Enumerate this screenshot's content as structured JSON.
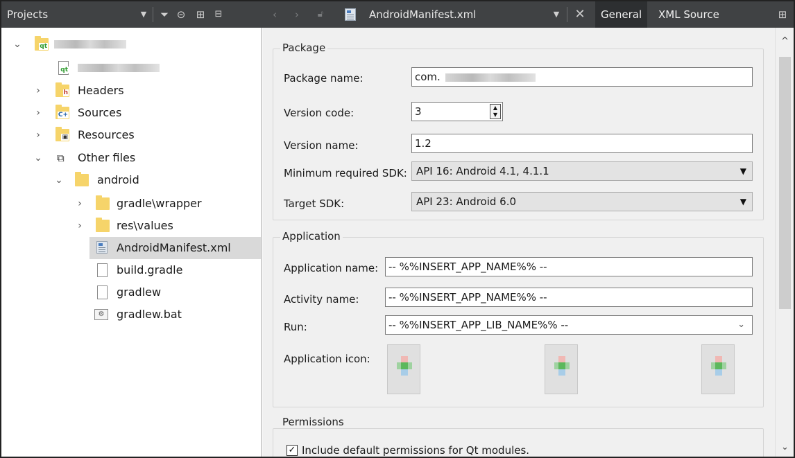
{
  "toolbar": {
    "projects_label": "Projects",
    "filename": "AndroidManifest.xml",
    "tabs": [
      {
        "label": "General",
        "active": true
      },
      {
        "label": "XML Source",
        "active": false
      }
    ]
  },
  "tree": {
    "items": [
      {
        "label": "",
        "icon": "qt-project-folder-icon",
        "expanded": true,
        "redacted": true
      },
      {
        "label": "",
        "icon": "qt-pro-file-icon",
        "redacted": true
      },
      {
        "label": "Headers",
        "icon": "headers-folder-icon",
        "expanded": false
      },
      {
        "label": "Sources",
        "icon": "sources-folder-icon",
        "expanded": false
      },
      {
        "label": "Resources",
        "icon": "resources-folder-icon",
        "expanded": false
      },
      {
        "label": "Other files",
        "icon": "other-files-icon",
        "expanded": true
      },
      {
        "label": "android",
        "icon": "folder-icon",
        "expanded": true
      },
      {
        "label": "gradle\\wrapper",
        "icon": "folder-icon",
        "expanded": false
      },
      {
        "label": "res\\values",
        "icon": "folder-icon",
        "expanded": false
      },
      {
        "label": "AndroidManifest.xml",
        "icon": "xml-file-icon",
        "selected": true
      },
      {
        "label": "build.gradle",
        "icon": "file-icon"
      },
      {
        "label": "gradlew",
        "icon": "file-icon"
      },
      {
        "label": "gradlew.bat",
        "icon": "bat-file-icon"
      }
    ]
  },
  "package": {
    "title": "Package",
    "package_name_label": "Package name:",
    "package_name_value": "com.",
    "version_code_label": "Version code:",
    "version_code_value": "3",
    "version_name_label": "Version name:",
    "version_name_value": "1.2",
    "min_sdk_label": "Minimum required SDK:",
    "min_sdk_value": "API 16: Android 4.1, 4.1.1",
    "target_sdk_label": "Target SDK:",
    "target_sdk_value": "API 23: Android 6.0"
  },
  "application": {
    "title": "Application",
    "app_name_label": "Application name:",
    "app_name_value": "-- %%INSERT_APP_NAME%% --",
    "activity_name_label": "Activity name:",
    "activity_name_value": "-- %%INSERT_APP_NAME%% --",
    "run_label": "Run:",
    "run_value": "-- %%INSERT_APP_LIB_NAME%% --",
    "app_icon_label": "Application icon:"
  },
  "permissions": {
    "title": "Permissions",
    "include_default_label": "Include default permissions for Qt modules.",
    "include_default_checked": true
  }
}
